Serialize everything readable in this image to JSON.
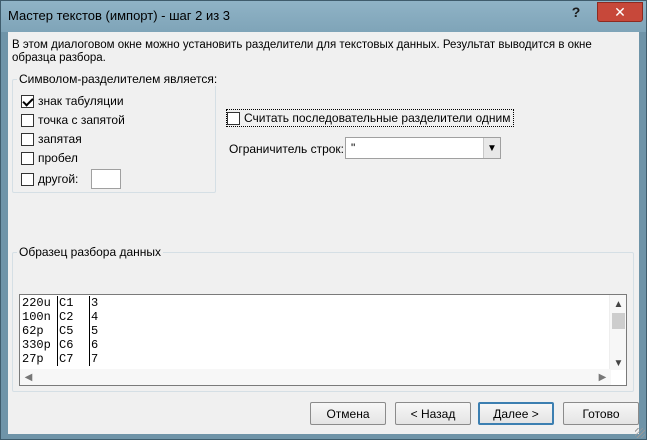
{
  "window": {
    "title": "Мастер текстов (импорт) - шаг 2 из 3",
    "help": "?",
    "close": "✕"
  },
  "description": "В этом диалоговом окне можно установить разделители для текстовых данных. Результат выводится в окне образца разбора.",
  "delimiters": {
    "title": "Символом-разделителем является:",
    "items": [
      {
        "label": "знак табуляции",
        "checked": true
      },
      {
        "label": "точка с запятой",
        "checked": false
      },
      {
        "label": "запятая",
        "checked": false
      },
      {
        "label": "пробел",
        "checked": false
      },
      {
        "label": "другой:",
        "checked": false
      }
    ]
  },
  "consecutive": {
    "label": "Считать последовательные разделители одним",
    "checked": false
  },
  "text_qualifier": {
    "label": "Ограничитель строк:",
    "value": "\""
  },
  "preview": {
    "title": "Образец разбора данных",
    "rows": [
      [
        "220u",
        "C1",
        "3"
      ],
      [
        "100n",
        "C2",
        "4"
      ],
      [
        "62p",
        "C5",
        "5"
      ],
      [
        "330p",
        "C6",
        "6"
      ],
      [
        "27p",
        "C7",
        "7"
      ]
    ]
  },
  "buttons": {
    "cancel": "Отмена",
    "back": "< Назад",
    "next": "Далее >",
    "finish": "Готово"
  }
}
